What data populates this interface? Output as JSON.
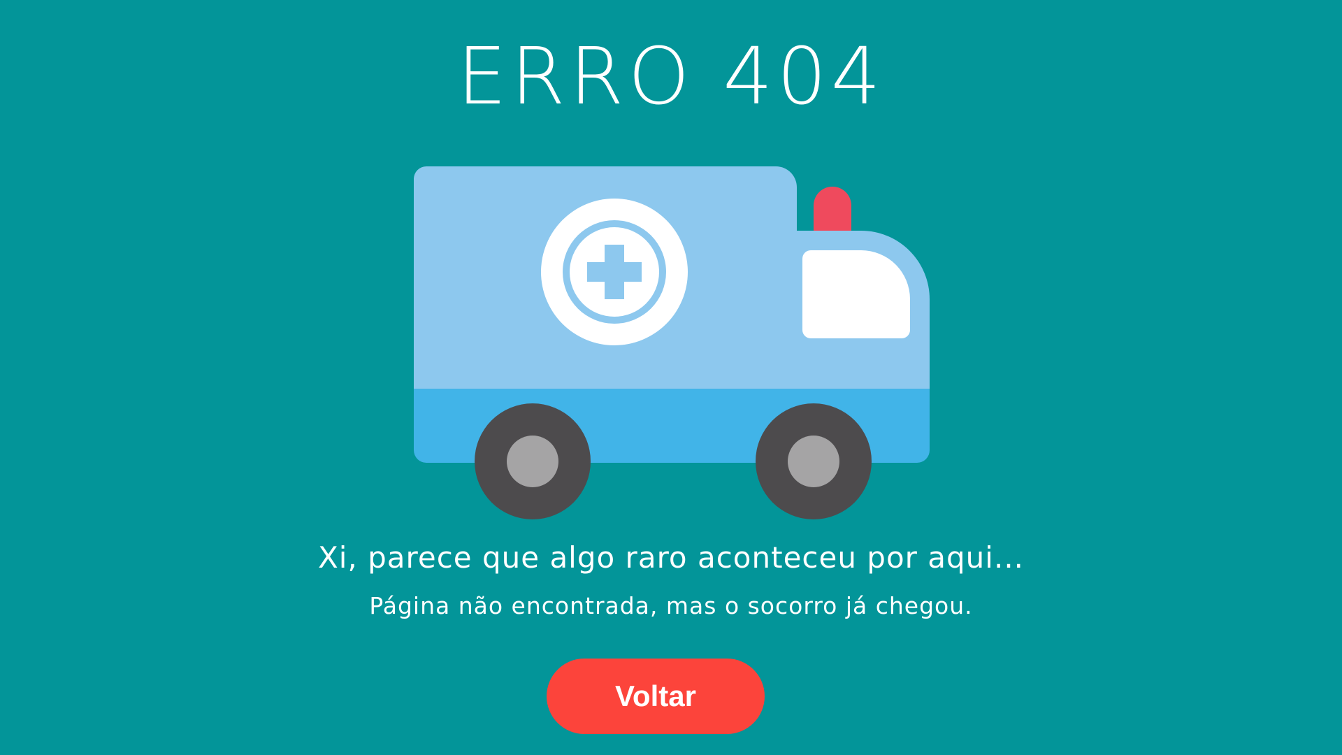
{
  "title": "ERRO 404",
  "message": {
    "headline": "Xi, parece que algo raro aconteceu por aqui...",
    "subline": "Página não encontrada, mas o socorro já chegou."
  },
  "actions": {
    "back_label": "Voltar"
  },
  "illustration": {
    "icon": "ambulance-icon",
    "colors": {
      "background": "#039599",
      "body_top": "#8dc8ee",
      "body_bottom": "#41b4e8",
      "window": "#ffffff",
      "siren": "#ef4a5d",
      "tire": "#4d4b4d",
      "hubcap": "#a5a4a5"
    }
  },
  "colors": {
    "background": "#039599",
    "button": "#fc443b",
    "text": "#ffffff"
  }
}
